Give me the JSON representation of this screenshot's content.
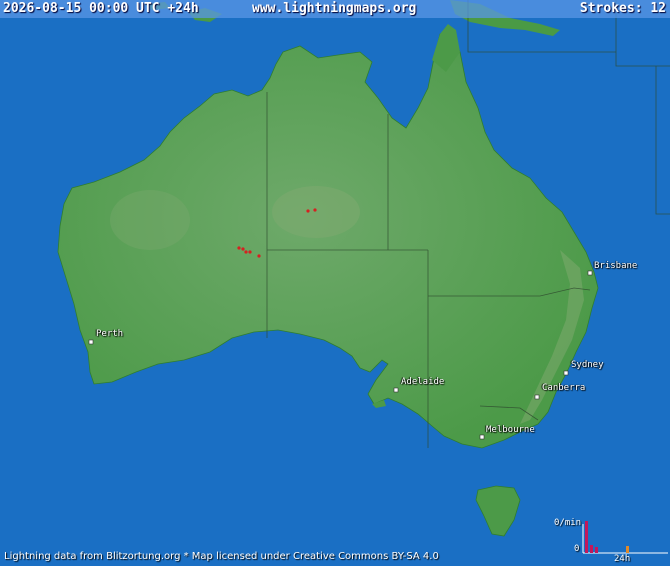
{
  "header": {
    "time_range": "2026-08-15 00:00 UTC +24h",
    "site": "www.lightningmaps.org",
    "strokes": "Strokes: 12"
  },
  "cities": [
    {
      "name": "Perth"
    },
    {
      "name": "Adelaide"
    },
    {
      "name": "Melbourne"
    },
    {
      "name": "Canberra"
    },
    {
      "name": "Sydney"
    },
    {
      "name": "Brisbane"
    }
  ],
  "histogram": {
    "rate_label": "0/min",
    "zero_label": "0",
    "span_label": "24h"
  },
  "footer": {
    "credit": "Lightning data from Blitzortung.org  *  Map licensed under Creative Commons BY-SA 4.0"
  },
  "colors": {
    "ocean": "#1a6fc4",
    "land": "#3f9a3f",
    "inland": "#5a9f5a",
    "strike": "#d62020",
    "histogram_bar": "#c2185b",
    "histogram_latest": "#e08a2a"
  }
}
